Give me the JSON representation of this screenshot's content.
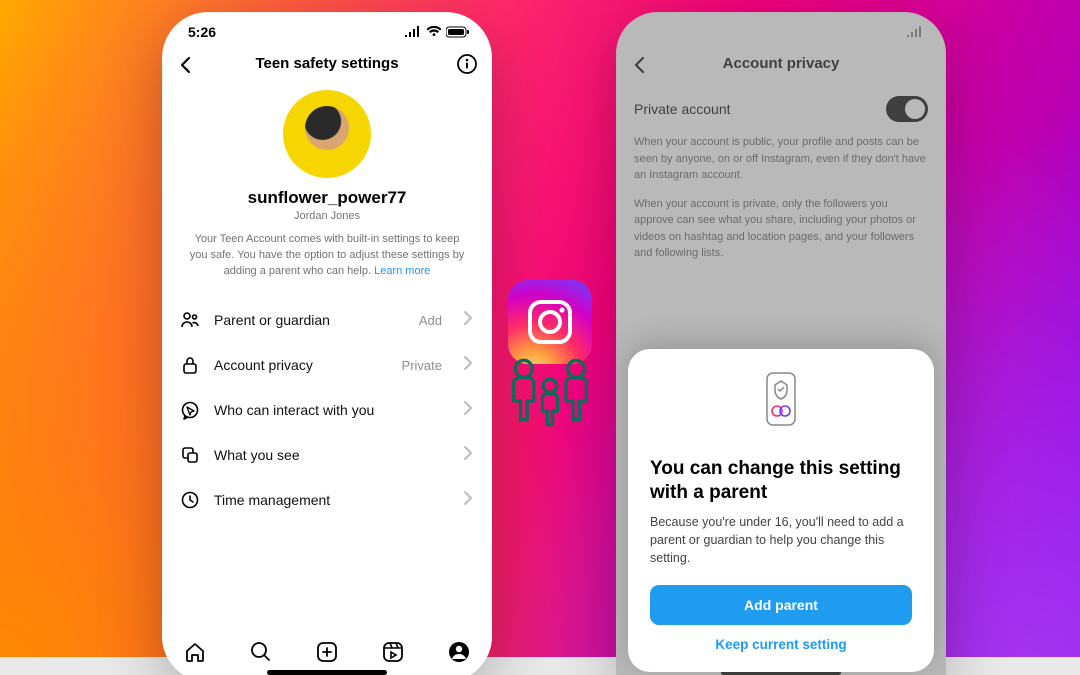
{
  "status_time": "5:26",
  "left": {
    "title": "Teen safety settings",
    "username": "sunflower_power77",
    "realname": "Jordan Jones",
    "blurb": "Your Teen Account comes with built-in settings to keep you safe. You have the option to adjust these settings by adding a parent who can help.",
    "learn_more": "Learn more",
    "rows": [
      {
        "label": "Parent or guardian",
        "value": "Add"
      },
      {
        "label": "Account privacy",
        "value": "Private"
      },
      {
        "label": "Who can interact with you",
        "value": ""
      },
      {
        "label": "What you see",
        "value": ""
      },
      {
        "label": "Time management",
        "value": ""
      }
    ]
  },
  "right": {
    "title": "Account privacy",
    "private_label": "Private account",
    "desc1": "When your account is public, your profile and posts can be seen by anyone, on or off Instagram, even if they don't have an Instagram account.",
    "desc2": "When your account is private, only the followers you approve can see what you share, including your photos or videos on hashtag and location pages, and your followers and following lists.",
    "sheet_title": "You can change this setting with a parent",
    "sheet_body": "Because you're under 16, you'll need to add a parent or guardian to help you change this setting.",
    "primary": "Add parent",
    "secondary": "Keep current setting"
  }
}
